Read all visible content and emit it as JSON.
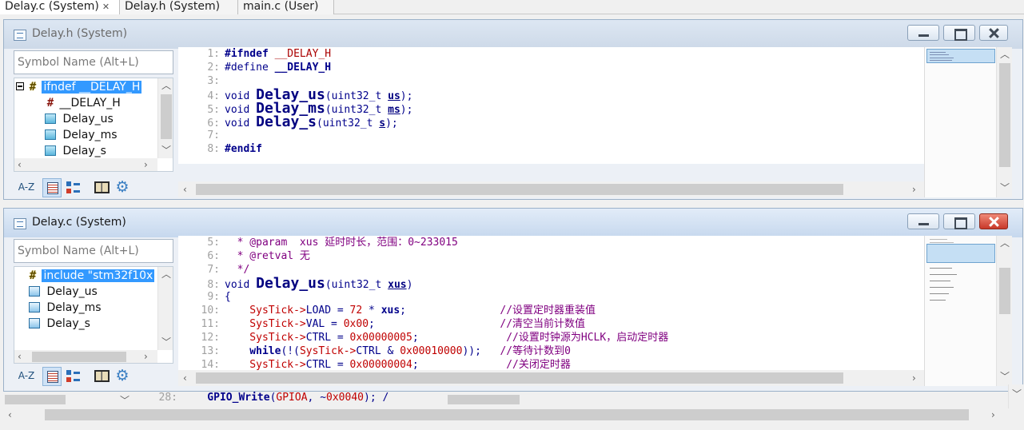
{
  "tabs": [
    {
      "label": "Delay.c (System)",
      "active": true,
      "close": "✕"
    },
    {
      "label": "Delay.h (System)",
      "active": false
    },
    {
      "label": "main.c (User)",
      "active": false
    }
  ],
  "top_window": {
    "title": "Delay.h (System)",
    "search_placeholder": "Symbol Name (Alt+L)",
    "symbols": [
      {
        "label": "ifndef __DELAY_H",
        "icon": "hash-yellow-icon",
        "selected": true
      },
      {
        "label": "__DELAY_H",
        "icon": "hash-red-icon"
      },
      {
        "label": "Delay_us",
        "icon": "function-icon"
      },
      {
        "label": "Delay_ms",
        "icon": "function-icon"
      },
      {
        "label": "Delay_s",
        "icon": "function-icon"
      }
    ],
    "code": [
      {
        "n": "1",
        "parts": [
          [
            "pp",
            "#ifndef "
          ],
          [
            "mac",
            "__DELAY_H"
          ]
        ]
      },
      {
        "n": "2",
        "parts": [
          [
            "plain",
            "#define "
          ],
          [
            "kw",
            "__DELAY_H"
          ]
        ]
      },
      {
        "n": "3",
        "parts": []
      },
      {
        "n": "4",
        "parts": [
          [
            "plain",
            "void "
          ],
          [
            "fnb",
            "Delay_us"
          ],
          [
            "plain",
            "(uint32_t "
          ],
          [
            "prm",
            "us"
          ],
          [
            "plain",
            ");"
          ]
        ]
      },
      {
        "n": "5",
        "parts": [
          [
            "plain",
            "void "
          ],
          [
            "fnb",
            "Delay_ms"
          ],
          [
            "plain",
            "(uint32_t "
          ],
          [
            "prm",
            "ms"
          ],
          [
            "plain",
            ");"
          ]
        ]
      },
      {
        "n": "6",
        "parts": [
          [
            "plain",
            "void "
          ],
          [
            "fnb",
            "Delay_s"
          ],
          [
            "plain",
            "(uint32_t "
          ],
          [
            "prm",
            "s"
          ],
          [
            "plain",
            ");"
          ]
        ]
      },
      {
        "n": "7",
        "parts": []
      },
      {
        "n": "8",
        "parts": [
          [
            "pp",
            "#endif"
          ]
        ]
      }
    ]
  },
  "bottom_window": {
    "title": "Delay.c (System)",
    "search_placeholder": "Symbol Name (Alt+L)",
    "symbols": [
      {
        "label": "include \"stm32f10x",
        "icon": "hash-yellow-icon",
        "selected": true
      },
      {
        "label": "Delay_us",
        "icon": "function-icon"
      },
      {
        "label": "Delay_ms",
        "icon": "function-icon"
      },
      {
        "label": "Delay_s",
        "icon": "function-icon"
      }
    ],
    "code": [
      {
        "n": "5",
        "parts": [
          [
            "cm",
            "  * @param  xus 延时时长，范围：0~233015"
          ]
        ]
      },
      {
        "n": "6",
        "parts": [
          [
            "cm",
            "  * @retval 无"
          ]
        ]
      },
      {
        "n": "7",
        "parts": [
          [
            "cm",
            "  */"
          ]
        ]
      },
      {
        "n": "8",
        "parts": [
          [
            "plain",
            "void "
          ],
          [
            "fnb",
            "Delay_us"
          ],
          [
            "plain",
            "(uint32_t "
          ],
          [
            "prm",
            "xus"
          ],
          [
            "plain",
            ")"
          ]
        ]
      },
      {
        "n": "9",
        "parts": [
          [
            "plain",
            "{"
          ]
        ]
      },
      {
        "n": "10",
        "parts": [
          [
            "rd",
            "    SysTick->"
          ],
          [
            "plain",
            "LOAD = "
          ],
          [
            "num",
            "72"
          ],
          [
            "plain",
            " * "
          ],
          [
            "kw",
            "xus"
          ],
          [
            "plain",
            ";               "
          ],
          [
            "cm",
            "//设置定时器重装值"
          ]
        ]
      },
      {
        "n": "11",
        "parts": [
          [
            "rd",
            "    SysTick->"
          ],
          [
            "plain",
            "VAL = "
          ],
          [
            "num",
            "0x00"
          ],
          [
            "plain",
            ";                    "
          ],
          [
            "cm",
            "//清空当前计数值"
          ]
        ]
      },
      {
        "n": "12",
        "parts": [
          [
            "rd",
            "    SysTick->"
          ],
          [
            "plain",
            "CTRL = "
          ],
          [
            "num",
            "0x00000005"
          ],
          [
            "plain",
            ";              "
          ],
          [
            "cm",
            "//设置时钟源为HCLK，启动定时器"
          ]
        ]
      },
      {
        "n": "13",
        "parts": [
          [
            "kw",
            "    while"
          ],
          [
            "plain",
            "(!("
          ],
          [
            "rd",
            "SysTick->"
          ],
          [
            "plain",
            "CTRL & "
          ],
          [
            "num",
            "0x00010000"
          ],
          [
            "plain",
            "));   "
          ],
          [
            "cm",
            "//等待计数到0"
          ]
        ]
      },
      {
        "n": "14",
        "parts": [
          [
            "rd",
            "    SysTick->"
          ],
          [
            "plain",
            "CTRL = "
          ],
          [
            "num",
            "0x00000004"
          ],
          [
            "plain",
            ";              "
          ],
          [
            "cm",
            "//关闭定时器"
          ]
        ]
      }
    ]
  },
  "background_code": {
    "n": "28",
    "parts": [
      [
        "kw",
        "    GPIO_Write"
      ],
      [
        "plain",
        "("
      ],
      [
        "rd",
        "GPIOA"
      ],
      [
        "plain",
        ", ~"
      ],
      [
        "num",
        "0x0040"
      ],
      [
        "plain",
        "); /"
      ]
    ]
  }
}
